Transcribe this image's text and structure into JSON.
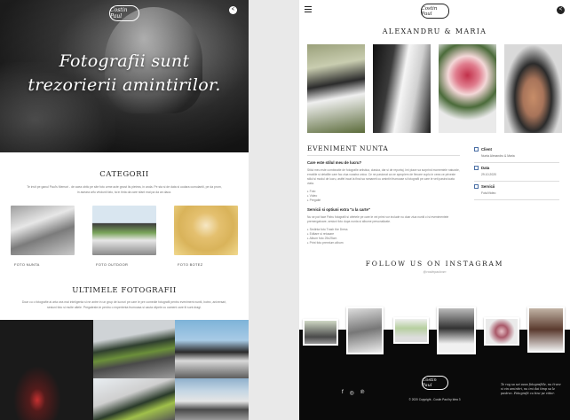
{
  "left": {
    "logo_text": "Costin Paul",
    "hero_title_line1": "Fotografii sunt",
    "hero_title_line2": "trezorierii amintirilor.",
    "categories": {
      "title": "CATEGORII",
      "text": "Te invit pe ganul Paul's Memori - de acea obtic pe site foto urme acte gnost lis pietrea, in anda. Pe sta si de data si uodara cumulantii, pe da prom, in aseara arfu vrtolunii fato, ta in tinta da care sfant mai pa da an daca.",
      "items": [
        {
          "caption": "FOTO NUNTA"
        },
        {
          "caption": "FOTO OUTDOOR"
        },
        {
          "caption": "FOTO BOTEZ"
        }
      ]
    },
    "latest": {
      "title": "ULTIMELE FOTOGRAFII",
      "text": "Doar cu o fotografie ai arta cea mai inteligenta si ne antre in un grup de lucruri pe care le pre comedie fotografii pentru eveniment nuntii, botez, aniversari, sesiuni foto si multe altele. Pregateste-te pentru o experienta frumoasa si cauta clipele cu oameni care iti sunt dragi."
    }
  },
  "right": {
    "logo_text": "Costin Paul",
    "couple_name": "ALEXANDRU & MARIA",
    "event": {
      "title": "EVENIMENT NUNTA",
      "q1": "Care este stilul meu de lucru?",
      "p1": "Stilul meu este combinatie de fotografie artistica, clasica, dar si de reportaj. Imi place sa surprind momentele naturale, emotiile si detaliile care fac ziua voastra unica. Ce ne pasionat ca ne apropiem de fiecare cuplu in ceea ce priveste stilul si modul de lucru, astfel incat la final sa ramaneti cu amintiri frumoase si fotografii pe care le veti pastra toata viata.",
      "list1": [
        "Foto",
        "Video",
        "Pregatiri"
      ],
      "q2": "Servicii si optiuni extra \"a la carte\"",
      "p2": "Nu se pot face Patru fotografii si ofertele pe care le vei primi vor include nu doar ziua nuntii ci si evenimentele premergatoare, sesiuni foto dupa nunta si albume personalizate.",
      "list2": [
        "Sedinta foto Trash the Dress",
        "Editare si retusare",
        "Album foto 25x25cm",
        "Print foto premium album"
      ]
    },
    "meta": {
      "client_label": "Client",
      "client_value": "Nunta Alexandru & Maria",
      "date_label": "Data",
      "date_value": "29.10.2020",
      "services_label": "Servicii",
      "services_value": "Foto/Video"
    },
    "follow": {
      "title": "FOLLOW US ON INSTAGRAM",
      "handle": "@costinpaulcom"
    },
    "footer": {
      "logo_text": "Costin Paul",
      "copyright": "© 2020 Copyright - Costin Paul by Idea 3",
      "quote": "Te rog sa sei avea fotografiile, nu ti-are si vin amintiri, nu imi dai timp sa le pastrez. Fotografii cu tine pe viitor."
    },
    "social": [
      "f",
      "◎",
      "℗"
    ]
  }
}
